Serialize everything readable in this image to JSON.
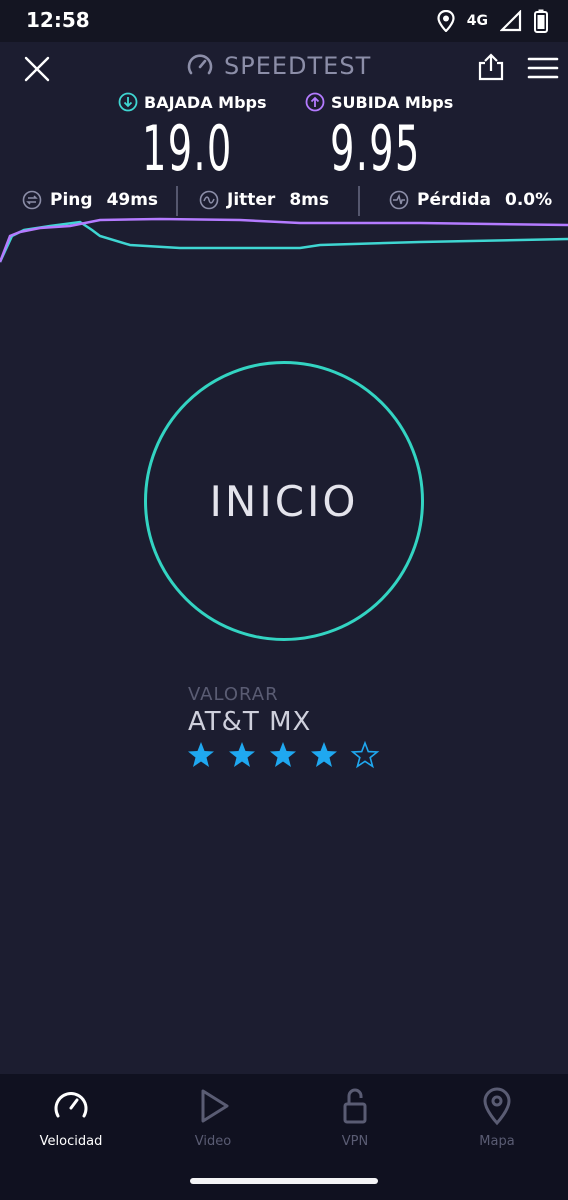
{
  "status_bar": {
    "time": "12:58",
    "network": "4G"
  },
  "header": {
    "title": "SPEEDTEST"
  },
  "download": {
    "label": "BAJADA Mbps",
    "value": "19.0"
  },
  "upload": {
    "label": "SUBIDA Mbps",
    "value": "9.95"
  },
  "stats": {
    "ping_label": "Ping",
    "ping_value": "49ms",
    "jitter_label": "Jitter",
    "jitter_value": "8ms",
    "loss_label": "Pérdida",
    "loss_value": "0.0%"
  },
  "start_button": {
    "label": "INICIO"
  },
  "rating": {
    "label": "VALORAR",
    "provider": "AT&T MX",
    "stars": 4,
    "max_stars": 5
  },
  "nav": [
    {
      "label": "Velocidad",
      "icon": "speedometer-icon",
      "active": true
    },
    {
      "label": "Video",
      "icon": "play-icon",
      "active": false
    },
    {
      "label": "VPN",
      "icon": "unlock-icon",
      "active": false
    },
    {
      "label": "Mapa",
      "icon": "map-pin-icon",
      "active": false
    }
  ],
  "colors": {
    "background": "#1c1d30",
    "download": "#3fd6d2",
    "upload": "#b47bff",
    "start_ring": "#33d4c2",
    "star": "#1fa8f0"
  }
}
